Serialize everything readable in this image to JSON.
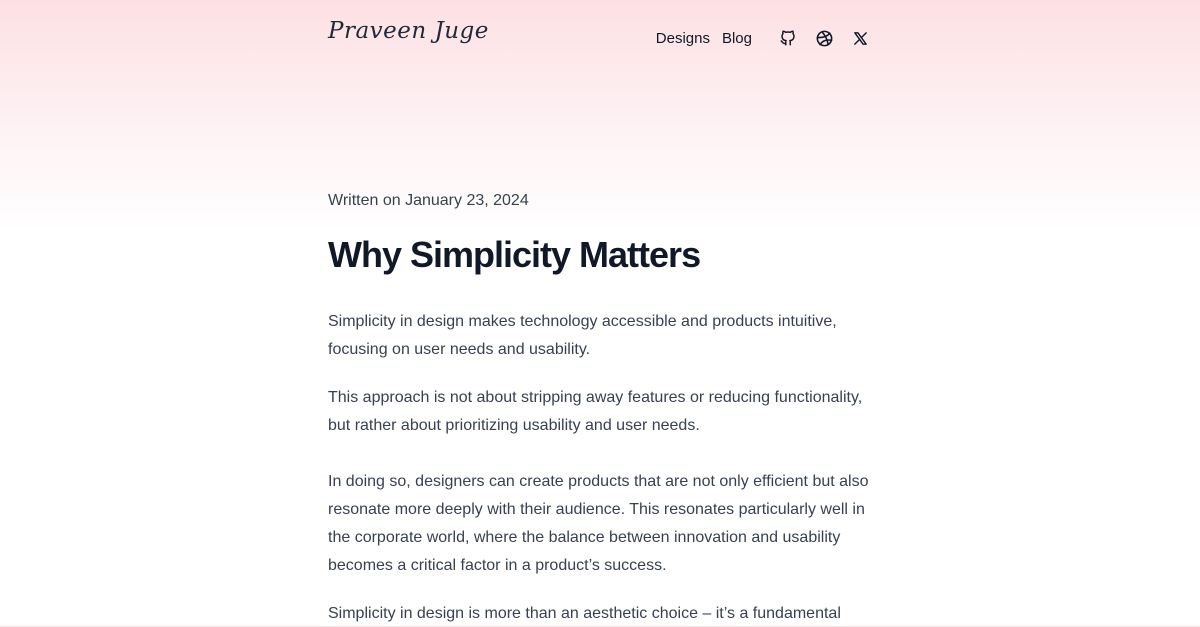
{
  "site": {
    "logo_text": "Praveen Juge"
  },
  "nav": {
    "designs_label": "Designs",
    "blog_label": "Blog",
    "icons": [
      "github-icon",
      "dribbble-icon",
      "x-icon"
    ]
  },
  "post": {
    "date": "Written on January 23, 2024",
    "title": "Why Simplicity Matters",
    "paragraphs": [
      "Simplicity in design makes technology accessible and products intuitive, focusing on user needs and usability.",
      "This approach is not about stripping away features or reducing functionality, but rather about prioritizing usability and user needs.",
      "In doing so, designers can create products that are not only efficient but also resonate more deeply with their audience. This resonates particularly well in the corporate world, where the balance between innovation and usability becomes a critical factor in a product’s success.",
      "Simplicity in design is more than an aesthetic choice – it’s a fundamental"
    ]
  },
  "colors": {
    "header_gradient_top": "#fde0e3",
    "title_color": "#111827",
    "text_color": "#374151"
  }
}
